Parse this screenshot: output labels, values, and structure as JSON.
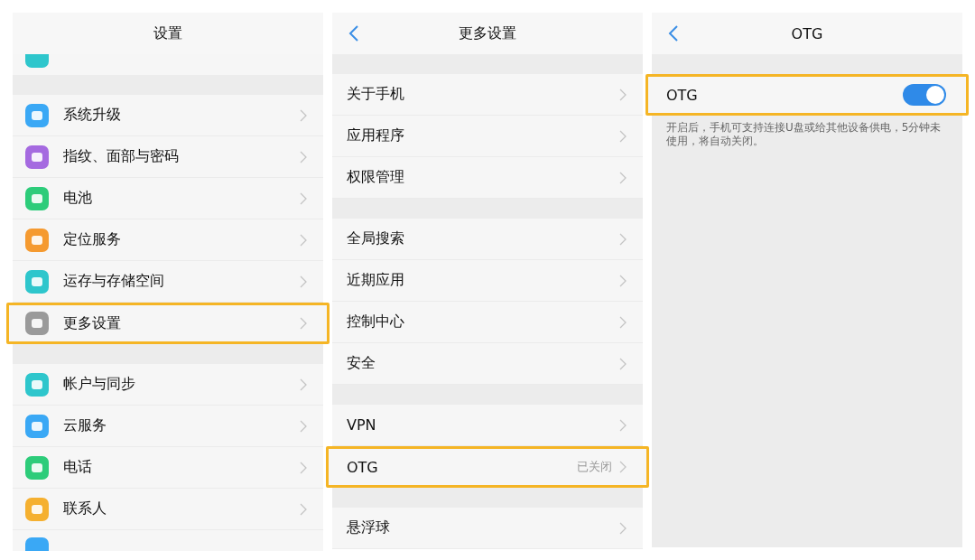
{
  "panels": [
    {
      "title": "设置",
      "back_button": false,
      "items": [
        {
          "kind": "partial_top",
          "color": "#2ec6cc"
        },
        {
          "kind": "gap"
        },
        {
          "kind": "row",
          "label": "系统升级",
          "color": "#3aa8f5",
          "highlighted": false
        },
        {
          "kind": "row",
          "label": "指纹、面部与密码",
          "color": "#a56ae0",
          "highlighted": false
        },
        {
          "kind": "row",
          "label": "电池",
          "color": "#2dcc7a",
          "highlighted": false
        },
        {
          "kind": "row",
          "label": "定位服务",
          "color": "#f59a30",
          "highlighted": false
        },
        {
          "kind": "row",
          "label": "运存与存储空间",
          "color": "#2ec6cc",
          "highlighted": false
        },
        {
          "kind": "row",
          "label": "更多设置",
          "color": "#9a9a9a",
          "highlighted": true
        },
        {
          "kind": "gap"
        },
        {
          "kind": "row",
          "label": "帐户与同步",
          "color": "#2ec6cc",
          "highlighted": false
        },
        {
          "kind": "row",
          "label": "云服务",
          "color": "#3aa8f5",
          "highlighted": false
        },
        {
          "kind": "row",
          "label": "电话",
          "color": "#2dcc7a",
          "highlighted": false
        },
        {
          "kind": "row",
          "label": "联系人",
          "color": "#f5b030",
          "highlighted": false
        },
        {
          "kind": "partial_bottom",
          "color": "#3aa8f5"
        }
      ]
    },
    {
      "title": "更多设置",
      "back_button": true,
      "items": [
        {
          "kind": "gap"
        },
        {
          "kind": "row",
          "label": "关于手机",
          "highlighted": false
        },
        {
          "kind": "row",
          "label": "应用程序",
          "highlighted": false
        },
        {
          "kind": "row",
          "label": "权限管理",
          "highlighted": false
        },
        {
          "kind": "gap"
        },
        {
          "kind": "row",
          "label": "全局搜索",
          "highlighted": false
        },
        {
          "kind": "row",
          "label": "近期应用",
          "highlighted": false
        },
        {
          "kind": "row",
          "label": "控制中心",
          "highlighted": false
        },
        {
          "kind": "row",
          "label": "安全",
          "highlighted": false
        },
        {
          "kind": "gap"
        },
        {
          "kind": "row",
          "label": "VPN",
          "highlighted": false
        },
        {
          "kind": "row",
          "label": "OTG",
          "value": "已关闭",
          "highlighted": true
        },
        {
          "kind": "gap"
        },
        {
          "kind": "row",
          "label": "悬浮球",
          "highlighted": false
        }
      ]
    },
    {
      "title": "OTG",
      "back_button": true,
      "items": [
        {
          "kind": "gap"
        },
        {
          "kind": "toggle",
          "label": "OTG",
          "on": true,
          "highlighted": true
        },
        {
          "kind": "note",
          "text": "开启后，手机可支持连接U盘或给其他设备供电，5分钟未使用，将自动关闭。"
        }
      ]
    }
  ]
}
